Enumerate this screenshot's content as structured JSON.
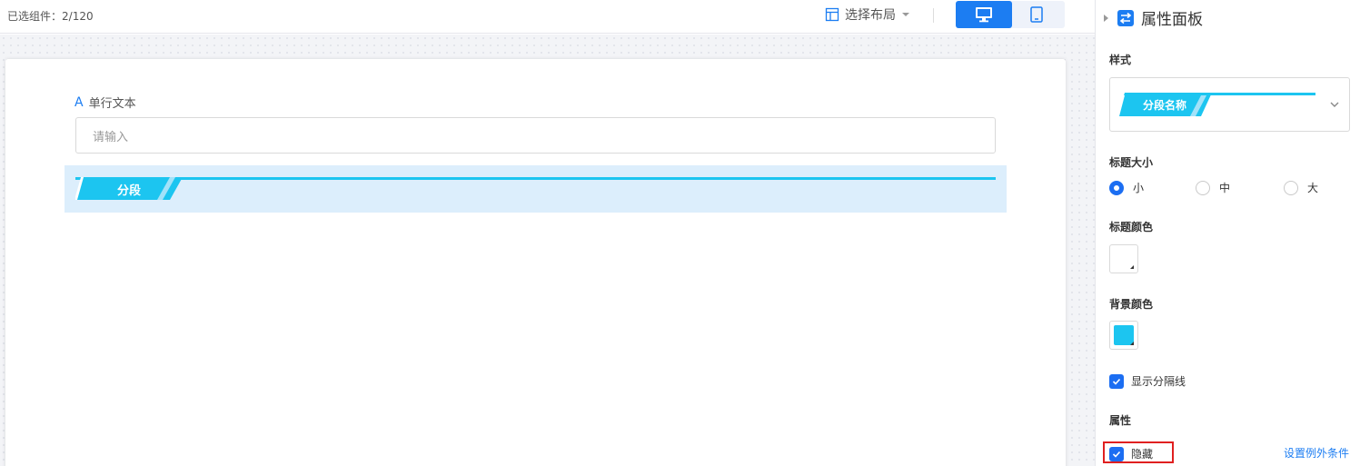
{
  "toolbar": {
    "selected_label": "已选组件：",
    "selected_count": "2/120",
    "layout_label": "选择布局"
  },
  "form": {
    "field_label": "单行文本",
    "field_placeholder": "请输入",
    "section_title": "分段"
  },
  "panel": {
    "title": "属性面板",
    "style_heading": "样式",
    "style_option": "分段名称",
    "size_heading": "标题大小",
    "size_options": [
      "小",
      "中",
      "大"
    ],
    "size_selected": "小",
    "title_color_heading": "标题颜色",
    "bg_color_heading": "背景颜色",
    "show_divider_label": "显示分隔线",
    "attr_heading": "属性",
    "hide_label": "隐藏",
    "exception_link": "设置例外条件"
  },
  "colors": {
    "accent": "#1c7df2",
    "section_cyan": "#1cc5f0",
    "section_bg": "#dceefc",
    "title_color": "#ffffff",
    "bg_color": "#1cc5f0",
    "highlight": "#e02020"
  }
}
